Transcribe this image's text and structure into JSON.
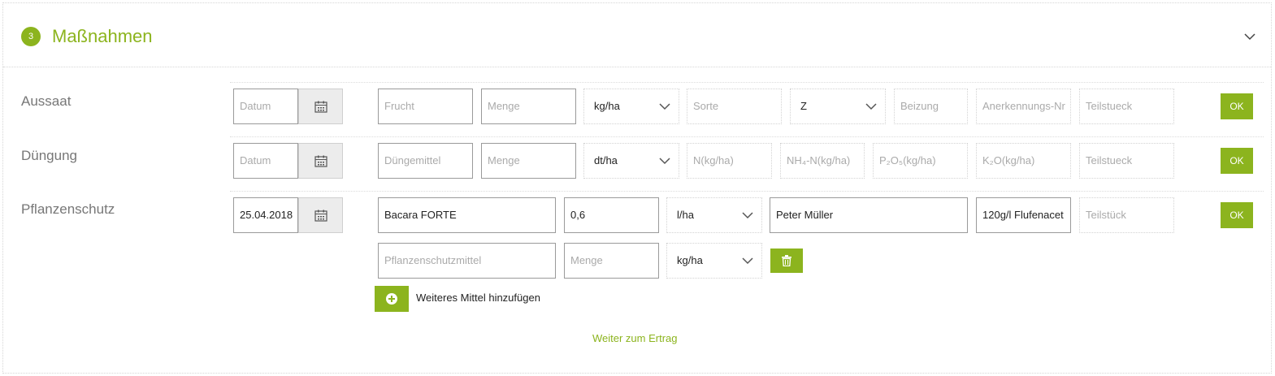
{
  "section": {
    "step": "3",
    "title": "Maßnahmen",
    "accent_color": "#8cb41e",
    "collapse_icon": "chevron-down-icon"
  },
  "rows": {
    "aussaat": {
      "label": "Aussaat",
      "date_placeholder": "Datum",
      "fields": [
        "Frucht",
        "Menge"
      ],
      "unit": "kg/ha",
      "sorte": "Sorte",
      "z_select": "Z",
      "beizung": "Beizung",
      "anerkennung": "Anerkennungs-Nr",
      "teilstueck": "Teilstueck",
      "ok": "OK"
    },
    "duengung": {
      "label": "Düngung",
      "date_placeholder": "Datum",
      "fields": [
        "Düngemittel",
        "Menge"
      ],
      "unit": "dt/ha",
      "nutrients": [
        "N(kg/ha)",
        "NH₄-N(kg/ha)",
        "P₂O₅(kg/ha)",
        "K₂O(kg/ha)"
      ],
      "teilstueck": "Teilstueck",
      "ok": "OK"
    },
    "pflanzenschutz": {
      "label": "Pflanzenschutz",
      "date": "25.04.2018",
      "mittel": "Bacara FORTE",
      "menge": "0,6",
      "unit": "l/ha",
      "person": "Peter Müller",
      "wirkstoff": "120g/l Flufenacet",
      "teilstueck": "Teilstück",
      "ok": "OK",
      "extra": {
        "mittel_placeholder": "Pflanzenschutzmittel",
        "menge_placeholder": "Menge",
        "unit": "kg/ha"
      }
    }
  },
  "add_label": "Weiteres Mittel hinzufügen",
  "continue_link": "Weiter zum Ertrag"
}
